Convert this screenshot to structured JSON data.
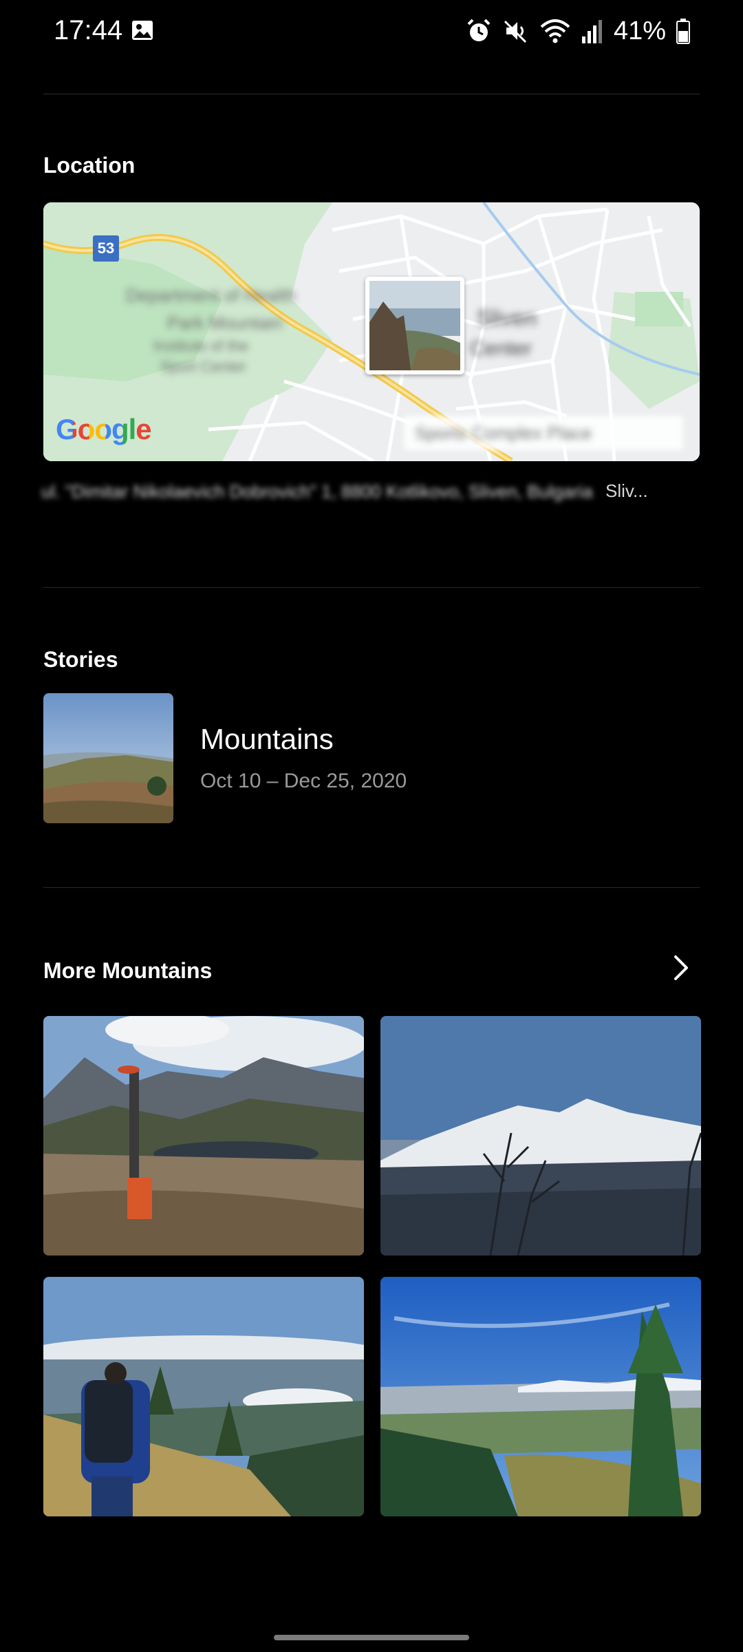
{
  "status_bar": {
    "time": "17:44",
    "battery": "41%",
    "icons": [
      "gallery-icon",
      "alarm-icon",
      "mute-icon",
      "wifi-icon",
      "signal-icon",
      "battery-icon"
    ]
  },
  "location": {
    "title": "Location",
    "map": {
      "route_number": "53",
      "logo": "Google",
      "blurred_labels": [
        "Department of Health",
        "Park Mountain",
        "Institute of the",
        "Sport Center",
        "Sliven",
        "Center",
        "Sports Complex Place"
      ]
    },
    "address": "ul. \"Dimitar Nikolaevich Dobrovich\" 1, 8800 Kotlikovo, Sliven, Bulgaria",
    "address_suffix": "Sliv..."
  },
  "stories": {
    "title": "Stories",
    "item": {
      "title": "Mountains",
      "date_range": "Oct 10 – Dec 25, 2020"
    }
  },
  "more": {
    "title": "More Mountains",
    "photos": [
      {
        "name": "photo-headstand"
      },
      {
        "name": "photo-snowy-peak"
      },
      {
        "name": "photo-hiker"
      },
      {
        "name": "photo-valley"
      }
    ]
  },
  "colors": {
    "background": "#000000",
    "text_primary": "#ffffff",
    "text_secondary": "#9a9a9a",
    "divider": "#2a2a2a"
  }
}
